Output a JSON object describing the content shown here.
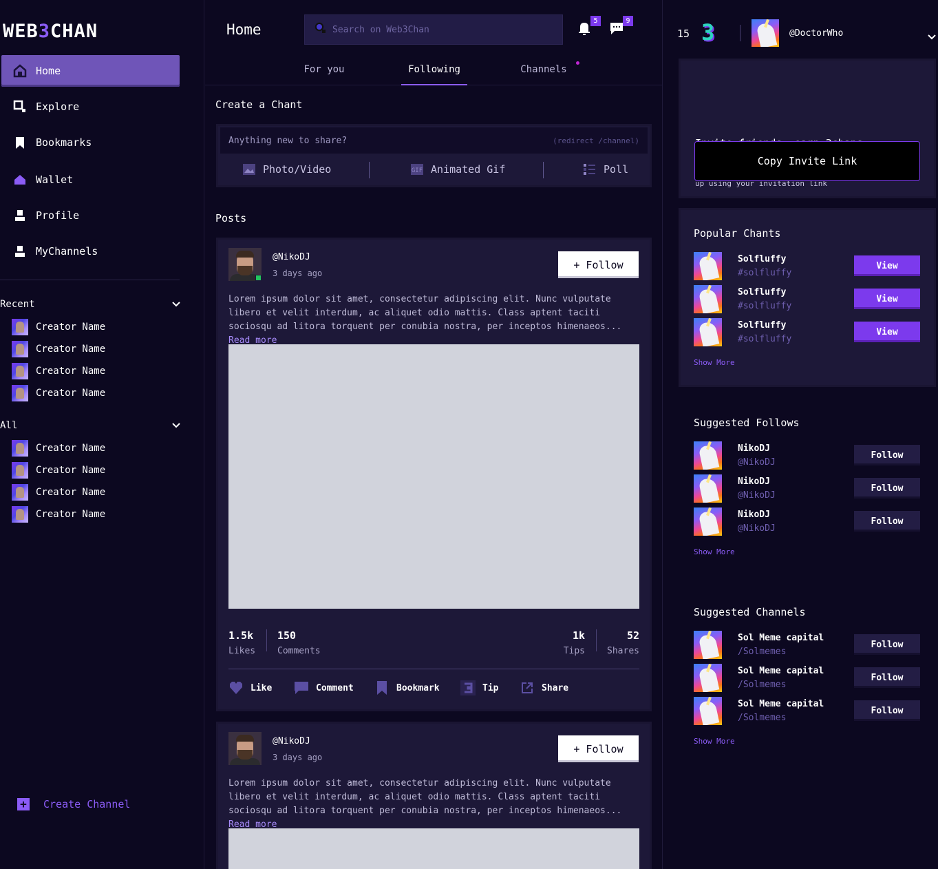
{
  "app": {
    "logo_part1": "WEB",
    "logo_part2": "3",
    "logo_part3": "CHAN"
  },
  "sidebar": {
    "nav": [
      {
        "label": "Home",
        "icon": "home-icon",
        "active": true
      },
      {
        "label": "Explore",
        "icon": "search-icon",
        "active": false
      },
      {
        "label": "Bookmarks",
        "icon": "bookmark-icon",
        "active": false
      },
      {
        "label": "Wallet",
        "icon": "wallet-icon",
        "active": false
      },
      {
        "label": "Profile",
        "icon": "profile-icon",
        "active": false
      },
      {
        "label": "MyChannels",
        "icon": "channels-icon",
        "active": false
      }
    ],
    "recent": {
      "title": "Recent",
      "items": [
        "Creator Name",
        "Creator Name",
        "Creator Name",
        "Creator Name"
      ]
    },
    "all": {
      "title": "All",
      "items": [
        "Creator Name",
        "Creator Name",
        "Creator Name",
        "Creator Name"
      ]
    },
    "create_channel": "Create Channel"
  },
  "header": {
    "title": "Home",
    "search_placeholder": "Search on Web3Chan",
    "notifications_count": "5",
    "messages_count": "9"
  },
  "tabs": [
    {
      "label": "For you",
      "active": false
    },
    {
      "label": "Following",
      "active": true
    },
    {
      "label": "Channels",
      "active": false,
      "dot": true
    }
  ],
  "composer": {
    "title": "Create a Chant",
    "placeholder": "Anything new to share?",
    "hint": "(redirect /channel)",
    "options": [
      "Photo/Video",
      "Animated Gif",
      "Poll"
    ]
  },
  "posts_title": "Posts",
  "posts": [
    {
      "handle": "@NikoDJ",
      "time": "3 days ago",
      "follow_label": "+ Follow",
      "body": "Lorem ipsum dolor sit amet, consectetur adipiscing elit. Nunc vulputate libero et velit interdum, ac aliquet odio mattis. Class aptent taciti sociosqu ad litora torquent per conubia nostra, per inceptos himenaeos...",
      "read_more": "Read more",
      "stats": {
        "likes_n": "1.5k",
        "likes_l": "Likes",
        "comments_n": "150",
        "comments_l": "Comments",
        "tips_n": "1k",
        "tips_l": "Tips",
        "shares_n": "52",
        "shares_l": "Shares"
      },
      "actions": [
        "Like",
        "Comment",
        "Bookmark",
        "Tip",
        "Share"
      ]
    },
    {
      "handle": "@NikoDJ",
      "time": "3 days ago",
      "follow_label": "+ Follow",
      "body": "Lorem ipsum dolor sit amet, consectetur adipiscing elit. Nunc vulputate libero et velit interdum, ac aliquet odio mattis. Class aptent taciti sociosqu ad litora torquent per conubia nostra, per inceptos himenaeos...",
      "read_more": "Read more"
    }
  ],
  "right": {
    "coin_count": "15",
    "coin_logo": "3",
    "user_handle": "@DoctorWho",
    "invite": {
      "title": "Invite friends, earn 3chans",
      "desc": "You and your friend each get 3chans if they sign up using your invitation link",
      "button": "Copy Invite Link"
    },
    "popular": {
      "title": "Popular Chants",
      "items": [
        {
          "name": "Solfluffy",
          "sub": "#solfluffy",
          "button": "View"
        },
        {
          "name": "Solfluffy",
          "sub": "#solfluffy",
          "button": "View"
        },
        {
          "name": "Solfluffy",
          "sub": "#solfluffy",
          "button": "View"
        }
      ],
      "show_more": "Show More"
    },
    "suggested_follows": {
      "title": "Suggested Follows",
      "items": [
        {
          "name": "NikoDJ",
          "sub": "@NikoDJ",
          "button": "Follow"
        },
        {
          "name": "NikoDJ",
          "sub": "@NikoDJ",
          "button": "Follow"
        },
        {
          "name": "NikoDJ",
          "sub": "@NikoDJ",
          "button": "Follow"
        }
      ],
      "show_more": "Show More"
    },
    "suggested_channels": {
      "title": "Suggested Channels",
      "items": [
        {
          "name": "Sol Meme capital",
          "sub": "/Solmemes",
          "button": "Follow"
        },
        {
          "name": "Sol Meme capital",
          "sub": "/Solmemes",
          "button": "Follow"
        },
        {
          "name": "Sol Meme capital",
          "sub": "/Solmemes",
          "button": "Follow"
        }
      ],
      "show_more": "Show More"
    }
  },
  "colors": {
    "background": "#0c0820",
    "card": "#1d1838",
    "accent": "#7c3aed",
    "active_nav": "#6f55b8"
  }
}
